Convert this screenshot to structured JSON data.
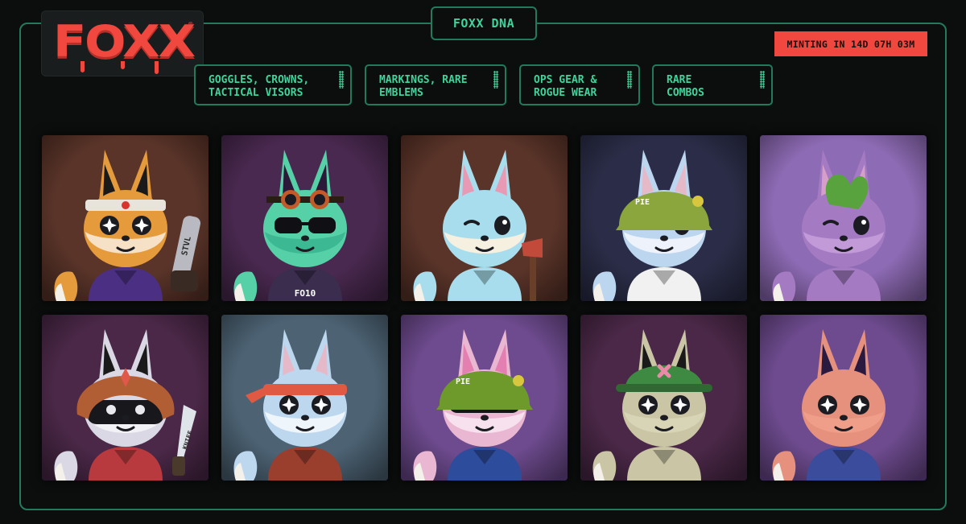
{
  "logo": {
    "text": "FOXX",
    "mark": "®"
  },
  "header": {
    "title": "FOXX DNA"
  },
  "minting": {
    "text": "MINTING IN 14D 07H 03M"
  },
  "filters": [
    {
      "line1": "GOGGLES, CROWNS,",
      "line2": "TACTICAL VISORS"
    },
    {
      "line1": "MARKINGS, RARE",
      "line2": "EMBLEMS"
    },
    {
      "line1": "OPS GEAR &",
      "line2": "ROGUE WEAR"
    },
    {
      "line1": "RARE",
      "line2": "COMBOS"
    }
  ],
  "gallery": [
    {
      "bg": "#5a3429",
      "fur": "#e59b3c",
      "ear": "#1a1a1a",
      "face": "#f6e1c6",
      "eye": "star",
      "hat": "headband",
      "accent": "#e8e4dc",
      "prop": "chainsaw",
      "prop_text": "STVL",
      "outfit": "#4b2f82"
    },
    {
      "bg": "#4a2950",
      "fur": "#56d0a6",
      "ear": "#2c1838",
      "face": "#3cb892",
      "eye": "shades",
      "hat": "goggles",
      "accent": "#c35a2a",
      "prop": "",
      "prop_text": "",
      "outfit": "#3a2d4e",
      "shirt_text": "FO10"
    },
    {
      "bg": "#5a3429",
      "fur": "#a7ddec",
      "ear": "#e89ab4",
      "face": "#f6f0e0",
      "eye": "wink",
      "hat": "",
      "accent": "#e07aa0",
      "prop": "axe",
      "prop_text": "",
      "outfit": "#a7ddec"
    },
    {
      "bg": "#2b2d48",
      "fur": "#bcd6f0",
      "ear": "#e6b9c8",
      "face": "#eef3fb",
      "eye": "wink",
      "hat": "helmet",
      "accent": "#8aa63c",
      "prop": "",
      "prop_text": "",
      "outfit": "#f1f1f1",
      "hat_text": "PIE"
    },
    {
      "bg": "#8e6bb5",
      "fur": "#a47bc3",
      "ear": "#d79ec9",
      "face": "#c29ad8",
      "eye": "wink",
      "hat": "leaf",
      "accent": "#58a33e",
      "prop": "",
      "prop_text": "",
      "outfit": "#a47bc3"
    },
    {
      "bg": "#4b2848",
      "fur": "#d9d8e4",
      "ear": "#1a1a1a",
      "face": "#f1f1f6",
      "eye": "mask",
      "hat": "ushanka",
      "accent": "#b25e34",
      "prop": "knife",
      "prop_text": "KNIFF",
      "outfit": "#b83a3e"
    },
    {
      "bg": "#4d6374",
      "fur": "#bdd7ee",
      "ear": "#e6b9c8",
      "face": "#eef5fb",
      "eye": "star",
      "hat": "bandana",
      "accent": "#e05a43",
      "prop": "",
      "prop_text": "",
      "outfit": "#9a3e2e"
    },
    {
      "bg": "#6e4b8f",
      "fur": "#eab7d2",
      "ear": "#e47fb1",
      "face": "#f8e1ee",
      "eye": "visor",
      "hat": "helmet",
      "accent": "#6d9a2a",
      "prop": "",
      "prop_text": "",
      "outfit": "#2e4c9c",
      "hat_text": "PIE"
    },
    {
      "bg": "#4b2848",
      "fur": "#c9c5a5",
      "ear": "#1a1a1a",
      "face": "#d8d4b6",
      "eye": "star",
      "hat": "cap",
      "accent": "#3f8a43",
      "prop": "",
      "prop_text": "",
      "outfit": "#c9c5a5"
    },
    {
      "bg": "#6e4b8f",
      "fur": "#e6907e",
      "ear": "#2a1a40",
      "face": "#ef9e8a",
      "eye": "star",
      "hat": "",
      "accent": "#e2a16d",
      "prop": "",
      "prop_text": "",
      "outfit": "#3b4c9c"
    }
  ]
}
